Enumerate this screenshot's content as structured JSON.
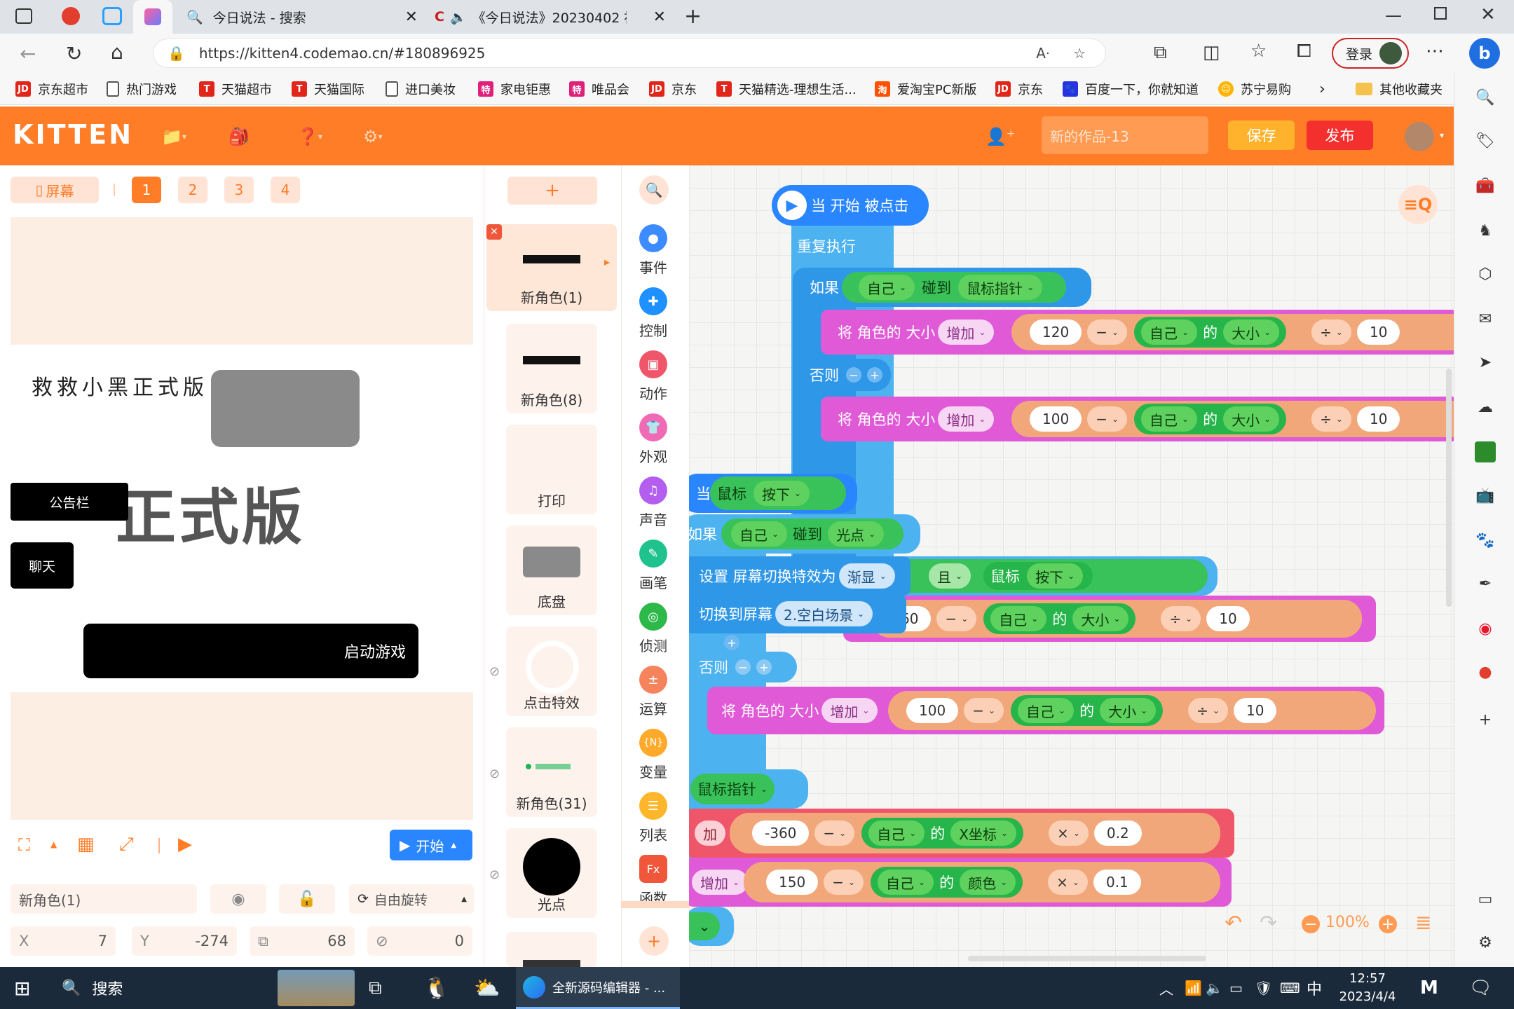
{
  "browser": {
    "tabs": [
      {
        "label": "今日说法 - 搜索"
      },
      {
        "label": "《今日说法》20230402 被"
      }
    ],
    "url": "https://kitten4.codemao.cn/#180896925",
    "login": "登录",
    "bookmarks": [
      "京东超市",
      "热门游戏",
      "天猫超市",
      "天猫国际",
      "进口美妆",
      "家电钜惠",
      "唯品会",
      "京东",
      "天猫精选-理想生活...",
      "爱淘宝PC新版",
      "京东",
      "百度一下，你就知道",
      "苏宁易购",
      "其他收藏夹"
    ]
  },
  "kitten": {
    "logo": "KITTEN",
    "work_title_placeholder": "新的作品-13",
    "save": "保存",
    "publish": "发布"
  },
  "stage": {
    "screen_btn": "屏幕",
    "screen_nums": [
      "1",
      "2",
      "3",
      "4"
    ],
    "title_text": "救救小黑正式版",
    "big_text": "正式版",
    "notice": "公告栏",
    "chat": "聊天",
    "start_game": "启动游戏",
    "run_btn": "开始"
  },
  "props": {
    "sprite_name": "新角色(1)",
    "rotation": "自由旋转",
    "x_label": "X",
    "x_value": "7",
    "y_label": "Y",
    "y_value": "-274",
    "size_value": "68",
    "dir_value": "0"
  },
  "sprites": [
    "新角色(1)",
    "新角色(8)",
    "打印",
    "底盘",
    "点击特效",
    "新角色(31)",
    "光点"
  ],
  "categories": [
    {
      "label": "事件",
      "color": "#3c8bff"
    },
    {
      "label": "控制",
      "color": "#1e90ff"
    },
    {
      "label": "动作",
      "color": "#f0566a"
    },
    {
      "label": "外观",
      "color": "#f06ab6"
    },
    {
      "label": "声音",
      "color": "#b45ef0"
    },
    {
      "label": "画笔",
      "color": "#1fc28c"
    },
    {
      "label": "侦测",
      "color": "#2db84a"
    },
    {
      "label": "运算",
      "color": "#f5835c"
    },
    {
      "label": "变量",
      "color": "#ffaa2b"
    },
    {
      "label": "列表",
      "color": "#ffb62b"
    },
    {
      "label": "函数",
      "color": "#f0563a"
    }
  ],
  "code": {
    "when_clicked": "当 开始 被点击",
    "repeat": "重复执行",
    "if": "如果",
    "self": "自己",
    "touch": "碰到",
    "mouse_pointer": "鼠标指针",
    "set_size": "将 角色的 大小",
    "increase": "增加",
    "n120": "120",
    "minus": "−",
    "of": "的",
    "size": "大小",
    "div": "÷",
    "n10": "10",
    "else": "否则",
    "n100": "100",
    "when": "当",
    "mouse": "鼠标",
    "pressed": "按下",
    "light_point": "光点",
    "set_transition": "设置 屏幕切换特效为",
    "fade": "渐显",
    "switch_screen": "切换到屏幕",
    "blank_scene": "2.空白场景",
    "pointer_partial": "指针",
    "and": "且",
    "n60": "60",
    "n_neg360": "-360",
    "x_coord": "X坐标",
    "times": "×",
    "n02": "0.2",
    "n150": "150",
    "color": "颜色",
    "n01": "0.1",
    "add_partial": "加",
    "increase_partial": "增加",
    "zoom": "100%"
  },
  "taskbar": {
    "search": "搜索",
    "app": "全新源码编辑器 - ...",
    "ime": "中",
    "time": "12:57",
    "date": "2023/4/4"
  }
}
